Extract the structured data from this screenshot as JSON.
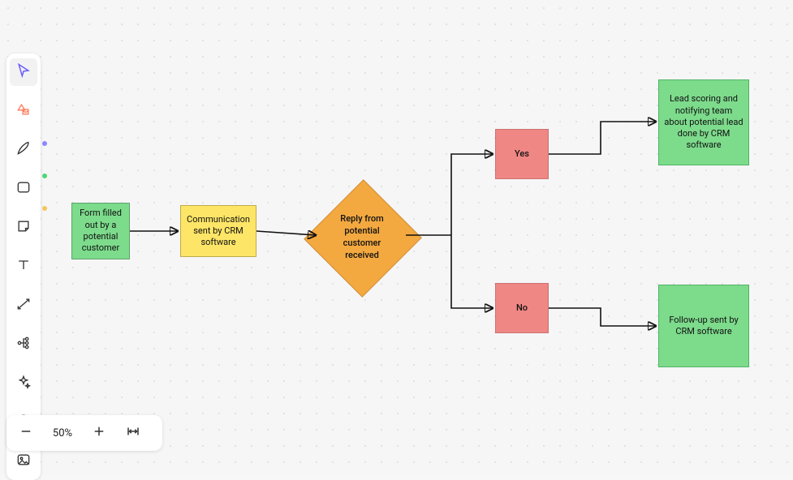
{
  "zoom": {
    "percent_label": "50%"
  },
  "toolbar": {
    "pointer_color": "#6b5cff",
    "shapes_color_accent": "#ff7a59",
    "pen_dot_color": "#8b87ff",
    "rect_dot_color": "#4fd675",
    "sticky_dot_color": "#f6c560"
  },
  "flow": {
    "nodes": {
      "form": {
        "label": "Form filled out by a potential customer"
      },
      "comm": {
        "label": "Communication sent by CRM software"
      },
      "reply": {
        "label": "Reply from potential customer received"
      },
      "yes": {
        "label": "Yes"
      },
      "no": {
        "label": "No"
      },
      "lead": {
        "label": "Lead scoring and notifying team about potential lead done by CRM software"
      },
      "follow": {
        "label": "Follow-up sent by CRM software"
      }
    },
    "colors": {
      "green": "#7ddb8c",
      "yellow": "#fde567",
      "orange": "#f3a940",
      "red": "#ef8784"
    }
  }
}
